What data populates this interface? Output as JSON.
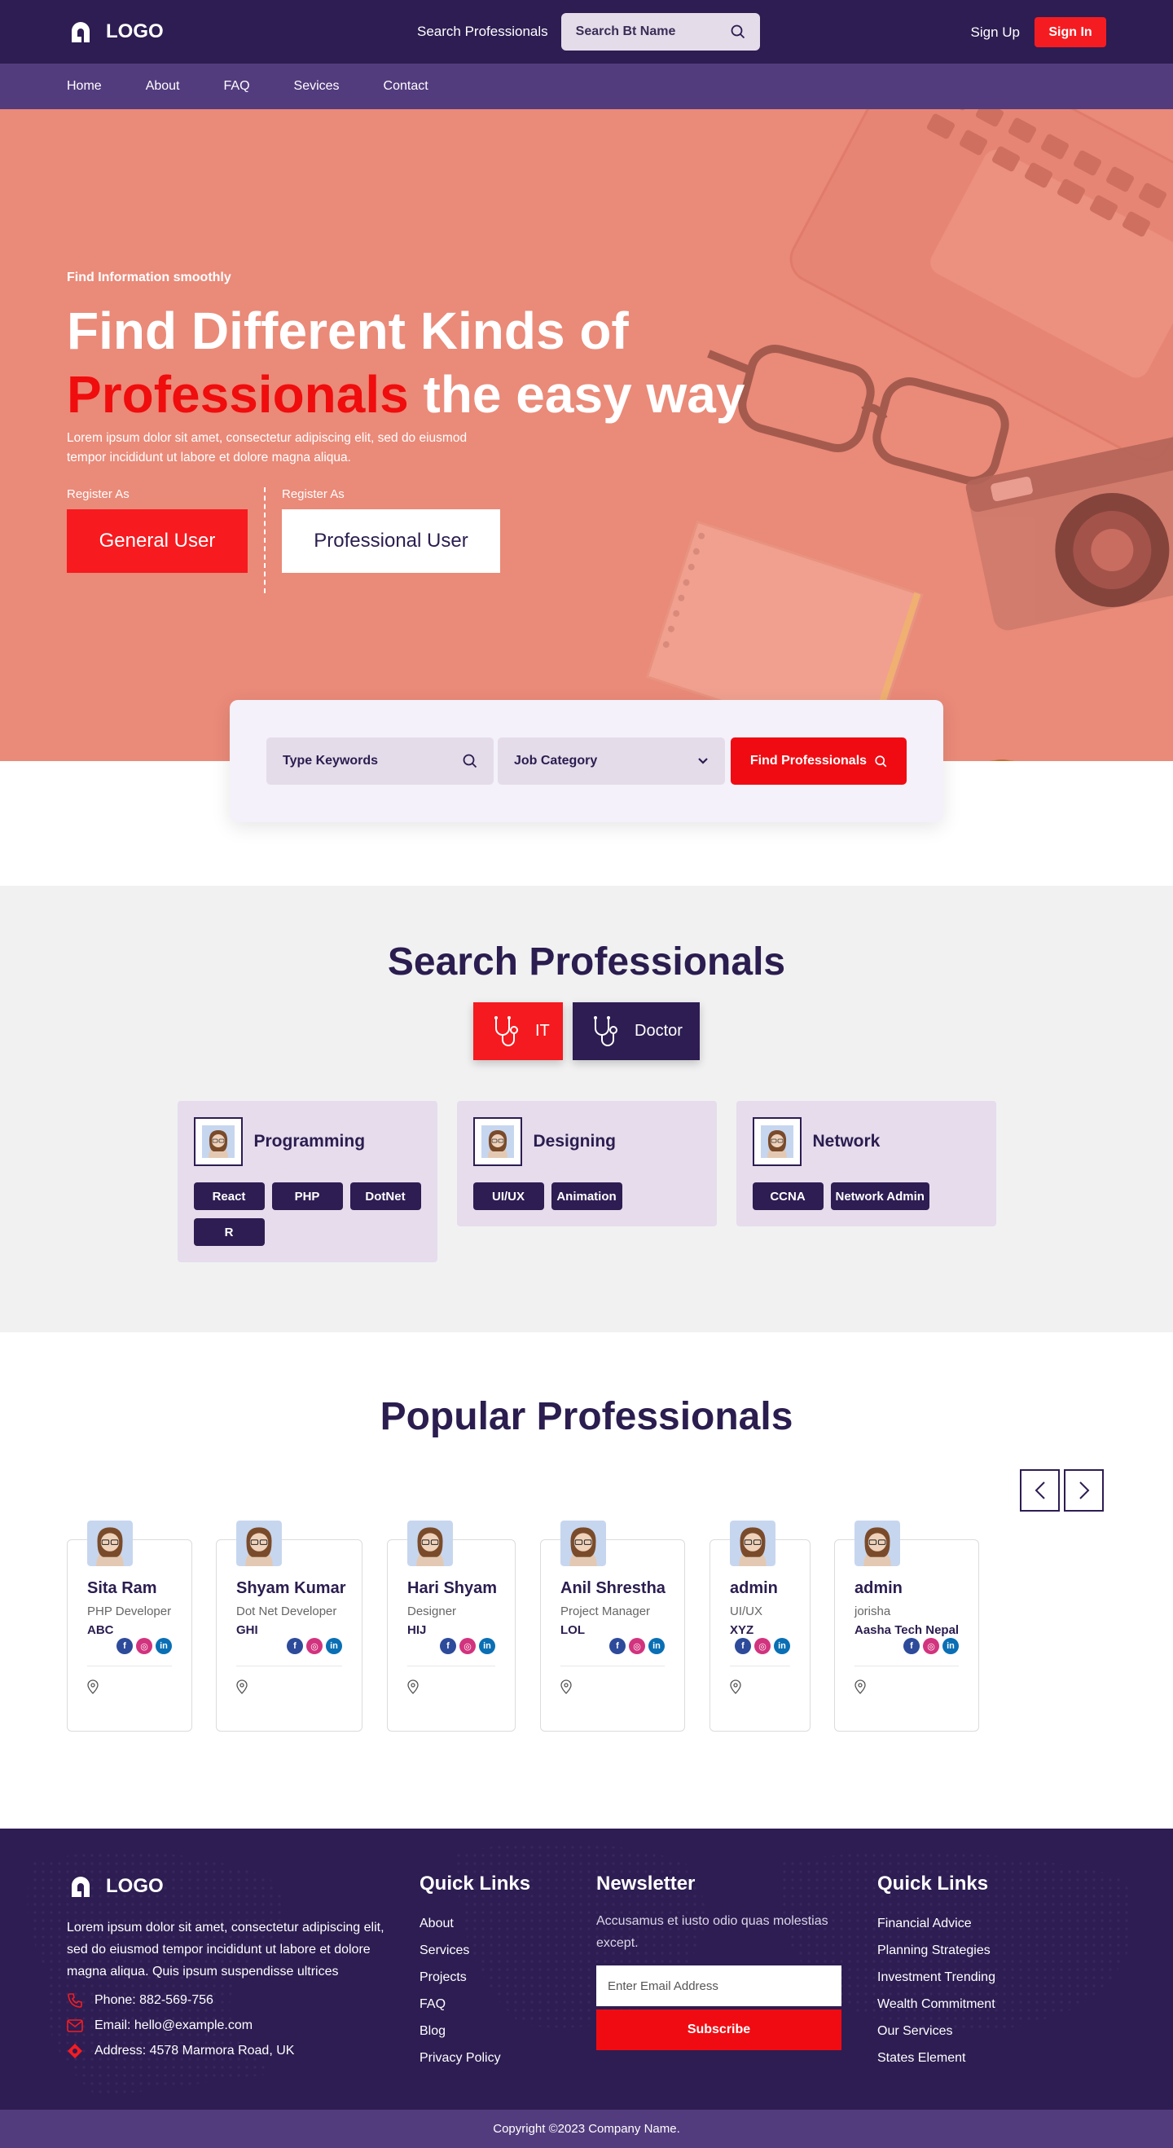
{
  "header": {
    "logo_text": "LOGO",
    "search_label": "Search Professionals",
    "search_placeholder": "Search Bt Name",
    "signup_label": "Sign Up",
    "signin_label": "Sign In"
  },
  "nav": {
    "items": [
      {
        "label": "Home"
      },
      {
        "label": "About"
      },
      {
        "label": "FAQ"
      },
      {
        "label": "Sevices"
      },
      {
        "label": "Contact"
      }
    ]
  },
  "hero": {
    "eyebrow": "Find Information smoothly",
    "title_line1": "Find Different Kinds of",
    "title_accent": "Professionals",
    "title_rest": " the easy way",
    "description": "Lorem ipsum dolor sit amet, consectetur adipiscing elit, sed do eiusmod tempor incididunt ut labore et dolore magna aliqua.",
    "register_label_1": "Register As",
    "register_label_2": "Register As",
    "general_user_label": "General User",
    "professional_user_label": "Professional User"
  },
  "filter": {
    "keyword_placeholder": "Type Keywords",
    "category_label": "Job Category",
    "find_label": "Find Professionals"
  },
  "search_section": {
    "title": "Search Professionals",
    "tabs": [
      {
        "label": "IT"
      },
      {
        "label": "Doctor"
      }
    ],
    "categories": [
      {
        "name": "Programming",
        "tags": [
          "React",
          "PHP",
          "DotNet",
          "R"
        ]
      },
      {
        "name": "Designing",
        "tags": [
          "UI/UX",
          "Animation"
        ]
      },
      {
        "name": "Network",
        "tags": [
          "CCNA",
          "Network Admin"
        ]
      }
    ]
  },
  "popular": {
    "title": "Popular Professionals",
    "professionals": [
      {
        "name": "Sita Ram",
        "role": "PHP Developer",
        "company": "ABC"
      },
      {
        "name": "Shyam Kumar",
        "role": "Dot Net Developer",
        "company": "GHI"
      },
      {
        "name": "Hari Shyam",
        "role": "Designer",
        "company": "HIJ"
      },
      {
        "name": "Anil Shrestha",
        "role": "Project Manager",
        "company": "LOL"
      },
      {
        "name": "admin",
        "role": "UI/UX",
        "company": "XYZ"
      },
      {
        "name": "admin",
        "role": "jorisha",
        "company": "Aasha Tech Nepal"
      }
    ]
  },
  "footer": {
    "logo_text": "LOGO",
    "description": "Lorem ipsum dolor sit amet, consectetur adipiscing elit, sed do eiusmod tempor incididunt ut labore et dolore magna aliqua. Quis ipsum suspendisse ultrices",
    "phone": "Phone: 882-569-756",
    "email": "Email: hello@example.com",
    "address": "Address: 4578 Marmora Road, UK",
    "quick_links_1_title": "Quick Links",
    "quick_links_1": [
      "About",
      "Services",
      "Projects",
      "FAQ",
      "Blog",
      "Privacy Policy"
    ],
    "newsletter_title": "Newsletter",
    "newsletter_desc": "Accusamus et iusto odio quas molestias except.",
    "email_placeholder": "Enter Email Address",
    "subscribe_label": "Subscribe",
    "quick_links_2_title": "Quick Links",
    "quick_links_2": [
      "Financial Advice",
      "Planning Strategies",
      "Investment Trending",
      "Wealth Commitment",
      "Our Services",
      "States Element"
    ],
    "copyright": "Copyright ©2023 Company Name."
  },
  "colors": {
    "primary": "#2d1d52",
    "secondary": "#533c7e",
    "accent": "#f51c21",
    "hero_bg": "#ea8a79"
  }
}
